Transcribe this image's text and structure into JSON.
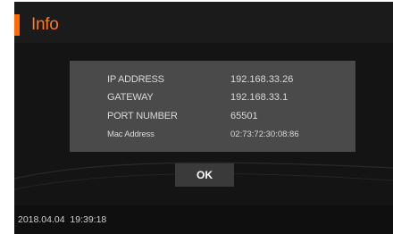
{
  "window": {
    "title": "Info"
  },
  "info": {
    "rows": [
      {
        "label": "IP ADDRESS",
        "value": "192.168.33.26"
      },
      {
        "label": "GATEWAY",
        "value": "192.168.33.1"
      },
      {
        "label": "PORT NUMBER",
        "value": "65501"
      },
      {
        "label": "Mac Address",
        "value": "02:73:72:30:08:86"
      }
    ]
  },
  "actions": {
    "ok_label": "OK"
  },
  "footer": {
    "datetime": "2018.04.04  19:39:18"
  },
  "colors": {
    "accent": "#ff6a00",
    "background": "#141414",
    "panel": "#4a4a4a",
    "button": "#3a3a3a"
  }
}
